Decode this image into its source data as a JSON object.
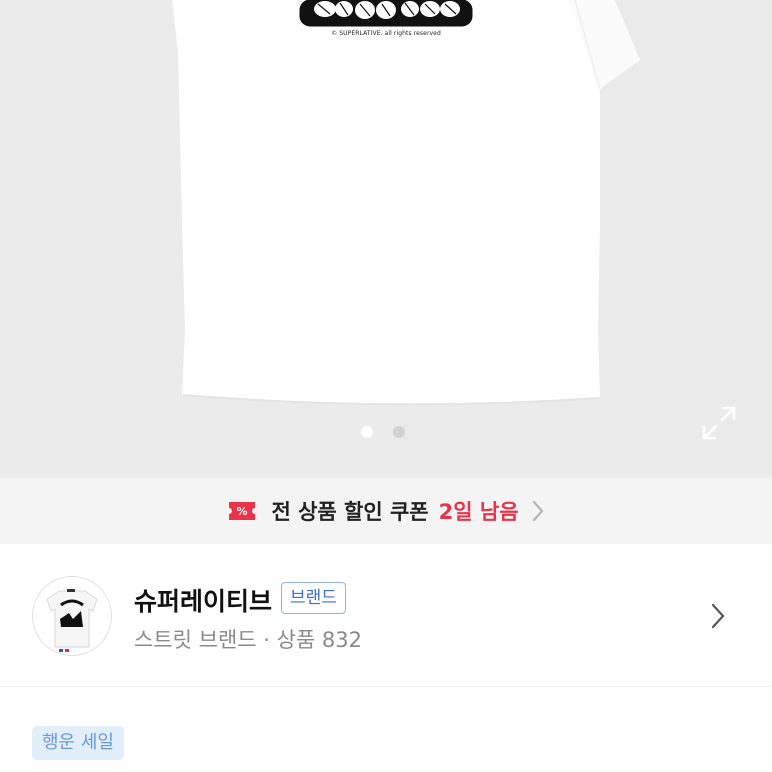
{
  "product_image": {
    "copyright_text": "© SUPERLATIVE. all rights reserved",
    "dots": [
      {
        "active": true
      },
      {
        "active": false
      }
    ]
  },
  "coupon": {
    "text": "전 상품 할인 쿠폰",
    "days_left": "2일 남음",
    "accent": "#e8334a"
  },
  "shop": {
    "name": "슈퍼레이티브",
    "badge": "브랜드",
    "meta": "스트릿 브랜드 · 상품 832"
  },
  "sale_tag": "행운 세일",
  "icons": [
    "expand-icon",
    "coupon-icon",
    "chevron-right-icon"
  ]
}
